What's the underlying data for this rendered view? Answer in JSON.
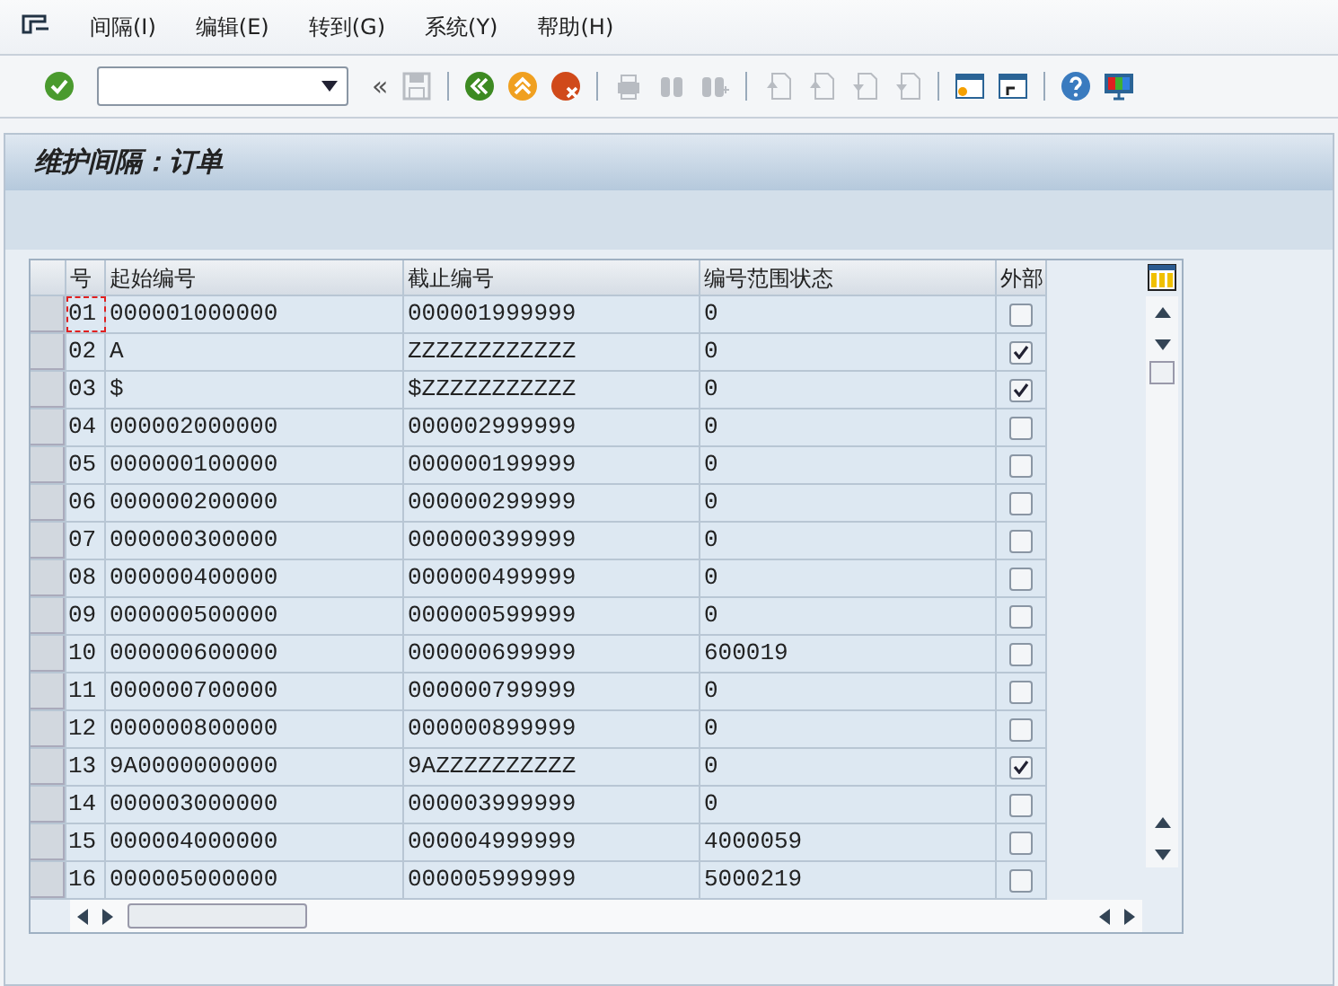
{
  "menu": [
    {
      "label": "间隔(I)"
    },
    {
      "label": "编辑(E)"
    },
    {
      "label": "转到(G)"
    },
    {
      "label": "系统(Y)"
    },
    {
      "label": "帮助(H)"
    }
  ],
  "toolbar": [
    {
      "kind": "enter",
      "disabled": false
    },
    {
      "kind": "command-field"
    },
    {
      "kind": "collapse",
      "label": "«",
      "disabled": false
    },
    {
      "kind": "save",
      "disabled": true
    },
    {
      "kind": "separator"
    },
    {
      "kind": "back",
      "disabled": false
    },
    {
      "kind": "exit",
      "disabled": false
    },
    {
      "kind": "cancel",
      "disabled": false
    },
    {
      "kind": "separator"
    },
    {
      "kind": "print",
      "disabled": true
    },
    {
      "kind": "find",
      "disabled": true
    },
    {
      "kind": "find-next",
      "disabled": true
    },
    {
      "kind": "separator"
    },
    {
      "kind": "first-page",
      "disabled": true
    },
    {
      "kind": "prev-page",
      "disabled": true
    },
    {
      "kind": "next-page",
      "disabled": true
    },
    {
      "kind": "last-page",
      "disabled": true
    },
    {
      "kind": "separator"
    },
    {
      "kind": "new-session",
      "disabled": false
    },
    {
      "kind": "shortcut",
      "disabled": false
    },
    {
      "kind": "separator"
    },
    {
      "kind": "help",
      "disabled": false
    },
    {
      "kind": "layout",
      "disabled": false
    }
  ],
  "title": "维护间隔：订单",
  "table": {
    "columns": [
      "号",
      "起始编号",
      "截止编号",
      "编号范围状态",
      "外部"
    ],
    "rows": [
      {
        "no": "01",
        "from": "000001000000",
        "to": "000001999999",
        "status": "0",
        "external": false,
        "focused": true
      },
      {
        "no": "02",
        "from": "A",
        "to": "ZZZZZZZZZZZZ",
        "status": "0",
        "external": true,
        "focused": false
      },
      {
        "no": "03",
        "from": "$",
        "to": "$ZZZZZZZZZZZ",
        "status": "0",
        "external": true,
        "focused": false
      },
      {
        "no": "04",
        "from": "000002000000",
        "to": "000002999999",
        "status": "0",
        "external": false,
        "focused": false
      },
      {
        "no": "05",
        "from": "000000100000",
        "to": "000000199999",
        "status": "0",
        "external": false,
        "focused": false
      },
      {
        "no": "06",
        "from": "000000200000",
        "to": "000000299999",
        "status": "0",
        "external": false,
        "focused": false
      },
      {
        "no": "07",
        "from": "000000300000",
        "to": "000000399999",
        "status": "0",
        "external": false,
        "focused": false
      },
      {
        "no": "08",
        "from": "000000400000",
        "to": "000000499999",
        "status": "0",
        "external": false,
        "focused": false
      },
      {
        "no": "09",
        "from": "000000500000",
        "to": "000000599999",
        "status": "0",
        "external": false,
        "focused": false
      },
      {
        "no": "10",
        "from": "000000600000",
        "to": "000000699999",
        "status": "600019",
        "external": false,
        "focused": false
      },
      {
        "no": "11",
        "from": "000000700000",
        "to": "000000799999",
        "status": "0",
        "external": false,
        "focused": false
      },
      {
        "no": "12",
        "from": "000000800000",
        "to": "000000899999",
        "status": "0",
        "external": false,
        "focused": false
      },
      {
        "no": "13",
        "from": "9A0000000000",
        "to": "9AZZZZZZZZZZ",
        "status": "0",
        "external": true,
        "focused": false
      },
      {
        "no": "14",
        "from": "000003000000",
        "to": "000003999999",
        "status": "0",
        "external": false,
        "focused": false
      },
      {
        "no": "15",
        "from": "000004000000",
        "to": "000004999999",
        "status": "4000059",
        "external": false,
        "focused": false
      },
      {
        "no": "16",
        "from": "000005000000",
        "to": "000005999999",
        "status": "5000219",
        "external": false,
        "focused": false
      }
    ]
  }
}
